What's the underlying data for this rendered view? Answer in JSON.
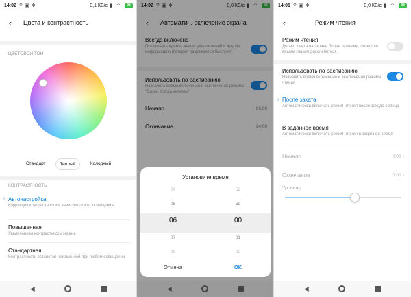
{
  "screen1": {
    "status": {
      "time": "14:02",
      "speed": "0,1 КБ/с",
      "battery": "98"
    },
    "title": "Цвета и контрастность",
    "section_color": "ЦВЕТОВОЙ ТОН",
    "presets": [
      "Стандарт",
      "Теплый",
      "Холодный"
    ],
    "section_contrast": "КОНТРАСТНОСТЬ",
    "items": [
      {
        "title": "Автонастройка",
        "subtitle": "Коррекция контрастности в зависимости от освещения"
      },
      {
        "title": "Повышенная",
        "subtitle": "Увеличенная контрастность экрана"
      },
      {
        "title": "Стандартная",
        "subtitle": "Контрастность останется неизменной при любом освещении"
      }
    ]
  },
  "screen2": {
    "status": {
      "time": "14:02",
      "speed": "0,0 КБ/с",
      "battery": "98"
    },
    "title": "Автоматич. включение экрана",
    "always_on": {
      "title": "Всегда включено",
      "subtitle": "Показывать время, значки уведомлений и другую информацию (батарея разряжается быстрее)"
    },
    "schedule": {
      "title": "Использовать по расписанию",
      "subtitle": "Назначить время включения и выключения режима \"Экран всегда активен\""
    },
    "start": {
      "label": "Начало",
      "value": "06:00"
    },
    "end": {
      "label": "Окончание",
      "value": "24:00"
    },
    "dialog": {
      "title": "Установите время",
      "hours": [
        "04",
        "05",
        "06",
        "07",
        "08"
      ],
      "minutes": [
        "58",
        "59",
        "00",
        "01",
        "02"
      ],
      "cancel": "Отмена",
      "ok": "OK"
    }
  },
  "screen3": {
    "status": {
      "time": "14:01",
      "speed": "0,0 КБ/с",
      "battery": "98"
    },
    "title": "Режим чтения",
    "reading": {
      "title": "Режим чтения",
      "subtitle": "Делает цвета на экране более теплыми, позволяя вашим глазам расслабиться"
    },
    "schedule": {
      "title": "Использовать по расписанию",
      "subtitle": "Назначить время включения и выключения режима чтения"
    },
    "sunset": {
      "title": "После заката",
      "subtitle": "Автоматически включать режим чтения после захода солнца"
    },
    "custom": {
      "title": "В заданное время",
      "subtitle": "Автоматически включать режим чтения в заданное время"
    },
    "start": {
      "label": "Начало",
      "value": "0:00"
    },
    "end": {
      "label": "Окончание",
      "value": "0:00"
    },
    "level": {
      "label": "Уровень",
      "value": 0.6
    }
  }
}
